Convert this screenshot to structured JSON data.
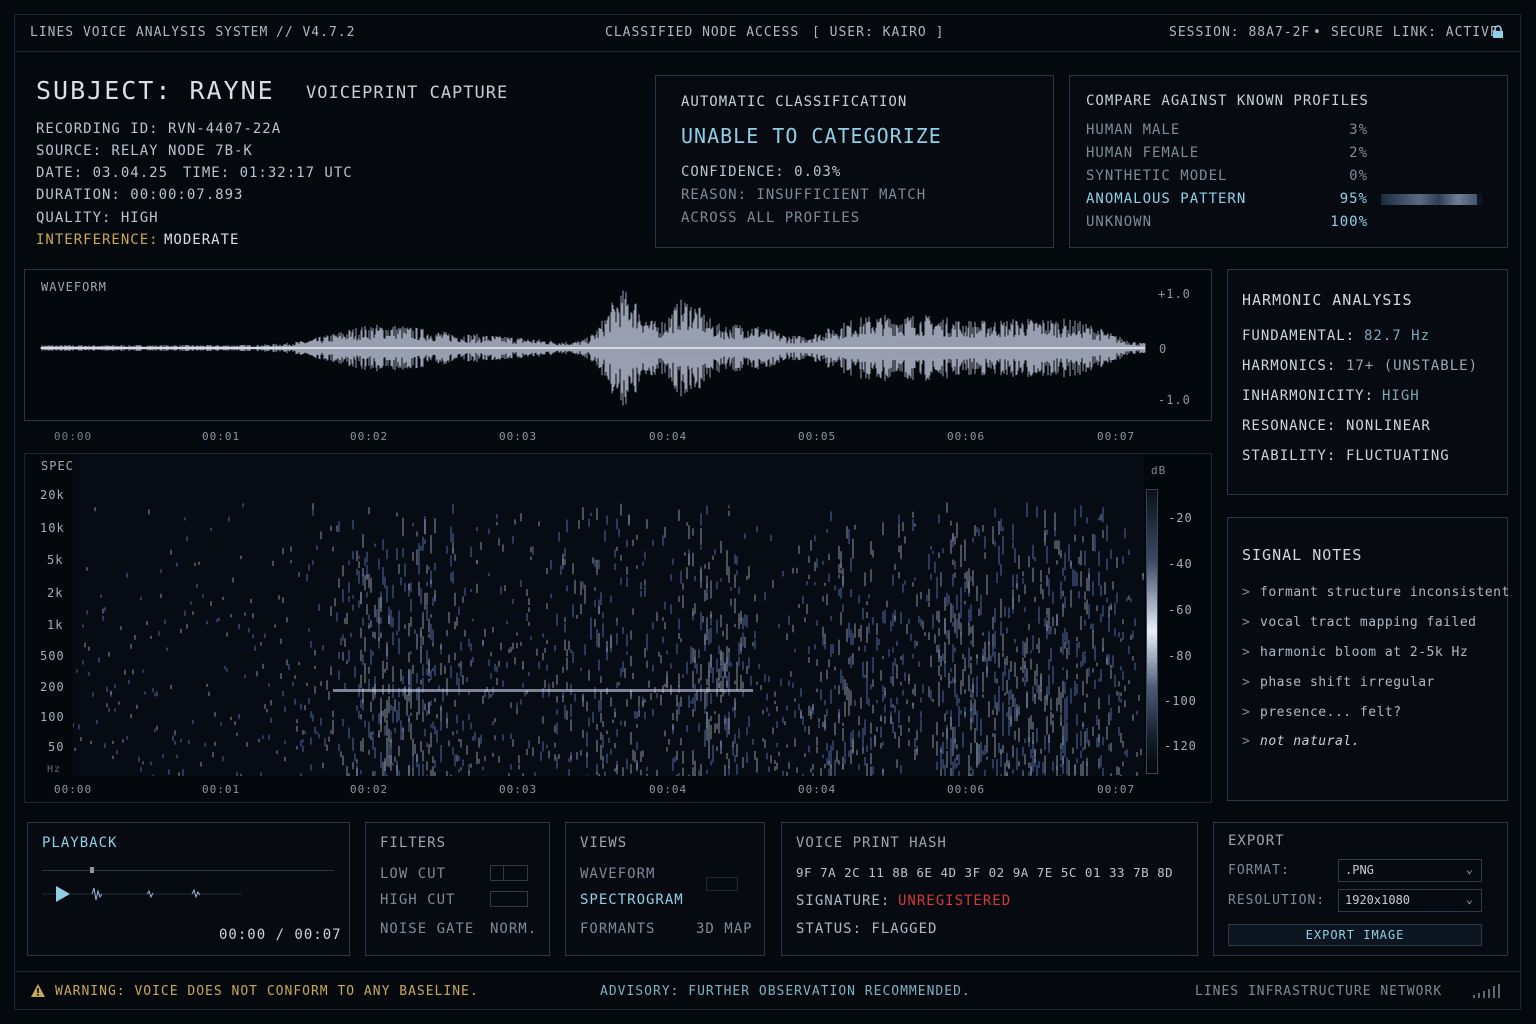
{
  "topbar": {
    "system": "LINES VOICE ANALYSIS SYSTEM",
    "version": "// V4.7.2",
    "access": "CLASSIFIED NODE ACCESS",
    "user": "[ USER: KAIRO ]",
    "session": "SESSION: 88A7-2F",
    "dot": "•",
    "link": "SECURE LINK: ACTIVE"
  },
  "subject": {
    "title": "SUBJECT: RAYNE",
    "capture": "VOICEPRINT CAPTURE",
    "recording_id": "RECORDING ID: RVN-4407-22A",
    "source": "SOURCE: RELAY NODE 7B-K",
    "date": "DATE: 03.04.25",
    "time": "TIME: 01:32:17 UTC",
    "duration": "DURATION: 00:00:07.893",
    "quality": "QUALITY: HIGH",
    "interference_label": "INTERFERENCE:",
    "interference_value": "MODERATE"
  },
  "classification": {
    "title": "AUTOMATIC CLASSIFICATION",
    "result": "UNABLE TO CATEGORIZE",
    "confidence": "CONFIDENCE: 0.03%",
    "reason_1": "REASON: INSUFFICIENT MATCH",
    "reason_2": "ACROSS ALL PROFILES"
  },
  "compare": {
    "title": "COMPARE AGAINST KNOWN PROFILES",
    "rows": [
      {
        "label": "HUMAN MALE",
        "value": "3%"
      },
      {
        "label": "HUMAN FEMALE",
        "value": "2%"
      },
      {
        "label": "SYNTHETIC MODEL",
        "value": "0%"
      },
      {
        "label": "ANOMALOUS PATTERN",
        "value": "95%"
      },
      {
        "label": "UNKNOWN",
        "value": "100%"
      }
    ],
    "anomalous_fill": 0.95
  },
  "waveform": {
    "title": "WAVEFORM",
    "amp_labels": [
      "+1.0",
      "0",
      "-1.0"
    ],
    "time_labels": [
      "00:00",
      "00:01",
      "00:02",
      "00:03",
      "00:04",
      "00:05",
      "00:06",
      "00:07"
    ]
  },
  "spectrogram": {
    "title": "SPECTROGRAM",
    "freq_labels": [
      "20k",
      "10k",
      "5k",
      "2k",
      "1k",
      "500",
      "200",
      "100",
      "50"
    ],
    "freq_unit": "Hz",
    "db_unit": "dB",
    "db_labels": [
      "-20",
      "-40",
      "-60",
      "-80",
      "-100",
      "-120"
    ],
    "time_labels": [
      "00:00",
      "00:01",
      "00:02",
      "00:03",
      "00:04",
      "00:04",
      "00:06",
      "00:07"
    ]
  },
  "harmonic": {
    "title": "HARMONIC ANALYSIS",
    "rows": [
      {
        "label": "FUNDAMENTAL:",
        "value": "82.7 Hz"
      },
      {
        "label": "HARMONICS:",
        "value": "17+ (UNSTABLE)"
      },
      {
        "label": "INHARMONICITY:",
        "value": "HIGH"
      },
      {
        "label": "RESONANCE:",
        "value": "NONLINEAR"
      },
      {
        "label": "STABILITY:",
        "value": "FLUCTUATING"
      }
    ]
  },
  "notes": {
    "title": "SIGNAL NOTES",
    "prompt": ">",
    "items": [
      "formant structure inconsistent",
      "vocal tract mapping failed",
      "harmonic bloom at 2-5k Hz",
      "phase shift irregular",
      "presence... felt?",
      "not natural."
    ]
  },
  "playback": {
    "title": "PLAYBACK",
    "time": "00:00 / 00:07",
    "icon": "play-icon"
  },
  "filters": {
    "title": "FILTERS",
    "low_cut": "LOW CUT",
    "high_cut": "HIGH CUT",
    "noise_gate": "NOISE GATE",
    "noise_gate_value": "NORM."
  },
  "views": {
    "title": "VIEWS",
    "waveform": "WAVEFORM",
    "spectrogram": "SPECTROGRAM",
    "formants": "FORMANTS",
    "map3d": "3D MAP"
  },
  "hash": {
    "title": "VOICE PRINT HASH",
    "value": "9F 7A 2C 11 8B 6E 4D 3F 02 9A 7E 5C 01 33 7B 8D",
    "signature_label": "SIGNATURE:",
    "signature_value": "UNREGISTERED",
    "status": "STATUS: FLAGGED"
  },
  "export": {
    "title": "EXPORT",
    "format_label": "FORMAT:",
    "format_value": ".PNG",
    "resolution_label": "RESOLUTION:",
    "resolution_value": "1920x1080",
    "button": "EXPORT IMAGE"
  },
  "footer": {
    "warning": "WARNING: VOICE DOES NOT CONFORM TO ANY BASELINE.",
    "advisory": "ADVISORY: FURTHER OBSERVATION RECOMMENDED.",
    "network": "LINES INFRASTRUCTURE NETWORK"
  },
  "colors": {
    "accent": "#8fd0e6",
    "warning": "#c7a85a",
    "alert": "#d23a3a",
    "signal": "#dfe8ff"
  }
}
